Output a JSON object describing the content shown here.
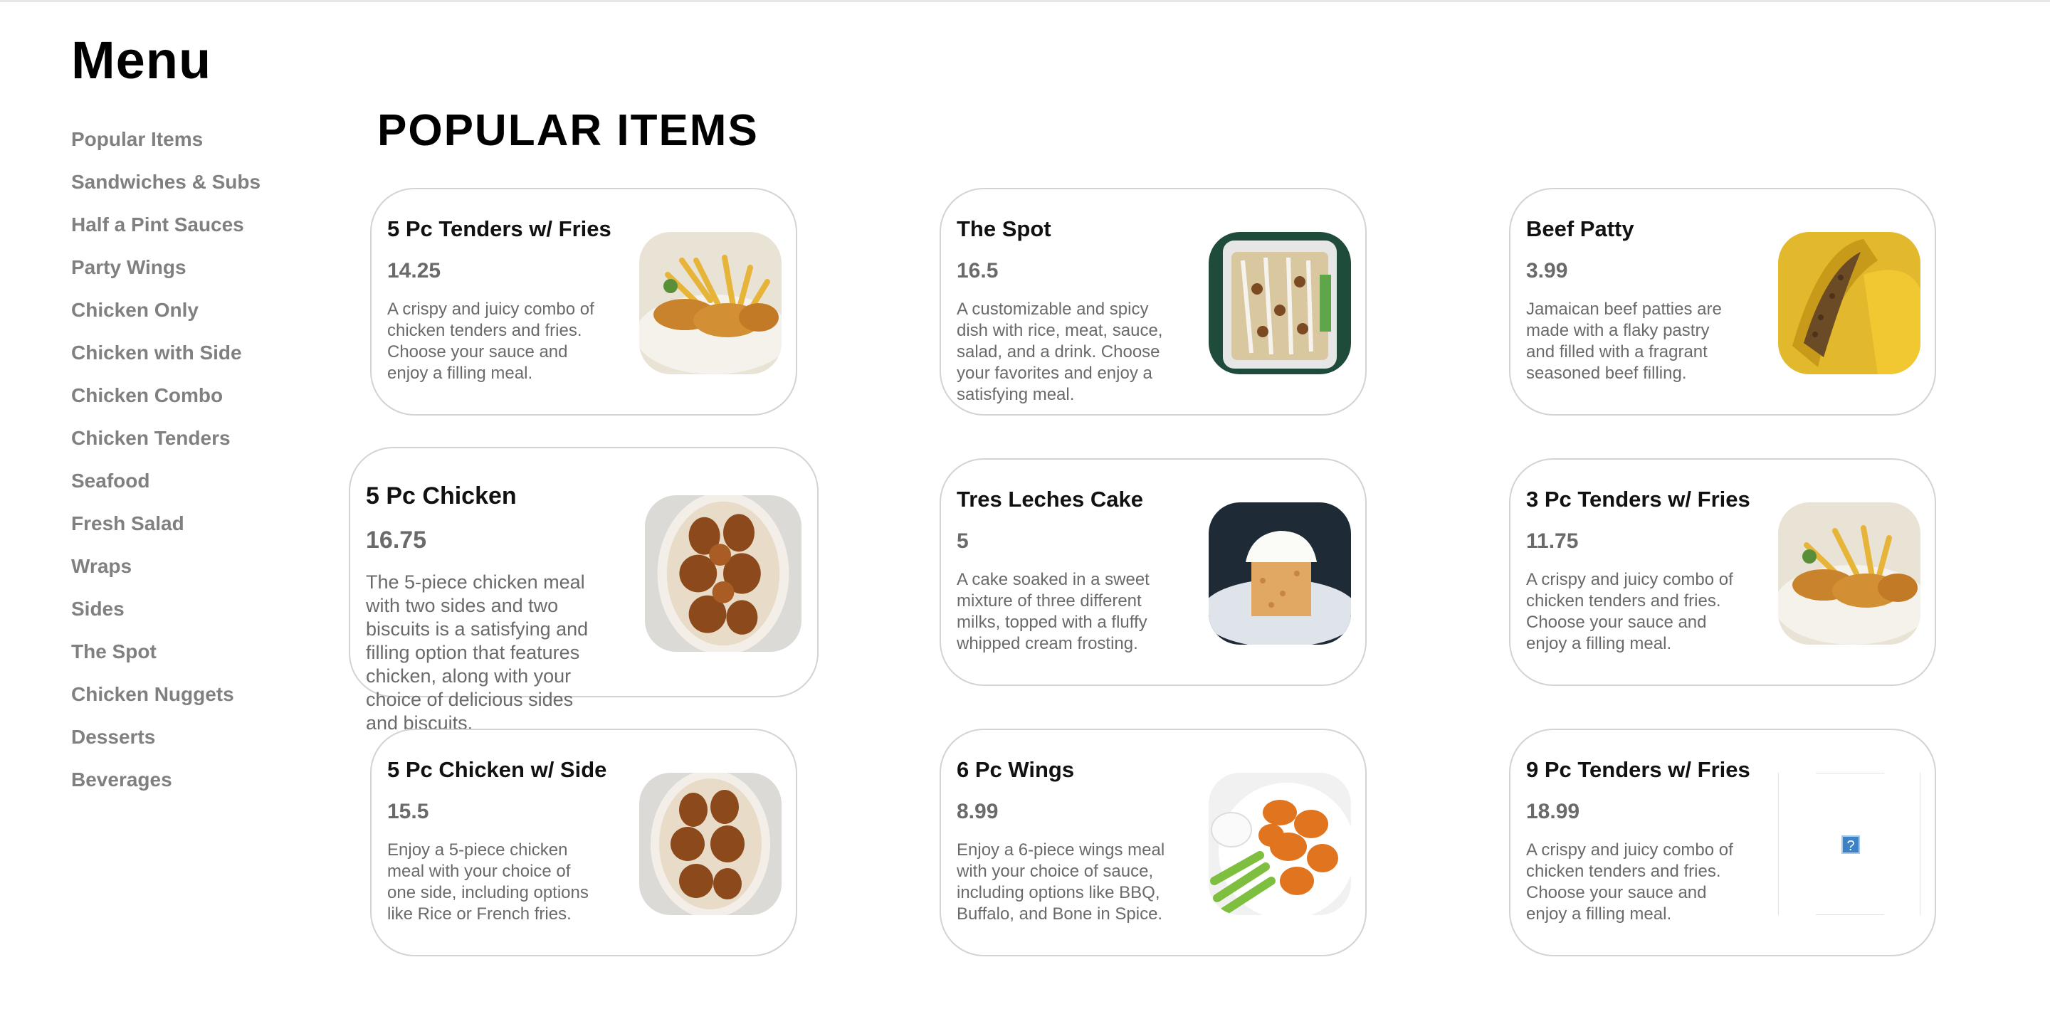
{
  "page": {
    "title": "Menu",
    "section_title": "POPULAR ITEMS"
  },
  "sidebar": {
    "items": [
      {
        "label": "Popular Items"
      },
      {
        "label": "Sandwiches & Subs"
      },
      {
        "label": "Half a Pint Sauces"
      },
      {
        "label": "Party Wings"
      },
      {
        "label": "Chicken Only"
      },
      {
        "label": "Chicken with Side"
      },
      {
        "label": "Chicken Combo"
      },
      {
        "label": "Chicken Tenders"
      },
      {
        "label": "Seafood"
      },
      {
        "label": "Fresh Salad"
      },
      {
        "label": "Wraps"
      },
      {
        "label": "Sides"
      },
      {
        "label": "The Spot"
      },
      {
        "label": "Chicken Nuggets"
      },
      {
        "label": "Desserts"
      },
      {
        "label": "Beverages"
      }
    ]
  },
  "items": [
    {
      "name": "5 Pc Tenders w/ Fries",
      "price": "14.25",
      "description": "A crispy and juicy combo of\nchicken tenders and fries.\nChoose your sauce and\nenjoy a filling meal.",
      "image": "tenders-and-fries-photo"
    },
    {
      "name": "The Spot",
      "price": "16.5",
      "description": "A customizable and spicy\ndish with rice, meat, sauce,\nsalad, and a drink. Choose\nyour favorites and enjoy a\nsatisfying meal.",
      "image": "rice-bowl-photo"
    },
    {
      "name": "Beef Patty",
      "price": "3.99",
      "description": "Jamaican beef patties are\nmade with a flaky pastry\nand filled with a fragrant\nseasoned beef filling.",
      "image": "beef-patty-photo"
    },
    {
      "name": "5 Pc Chicken",
      "price": "16.75",
      "description": "The 5-piece chicken meal\nwith two sides and two\nbiscuits is a satisfying and\nfilling option that features\nchicken, along with your\nchoice of delicious sides\nand biscuits.",
      "image": "fried-chicken-photo"
    },
    {
      "name": "Tres Leches Cake",
      "price": "5",
      "description": "A cake soaked in a sweet\nmixture of three different\nmilks, topped with a fluffy\nwhipped cream frosting.",
      "image": "cake-photo"
    },
    {
      "name": "3 Pc Tenders w/ Fries",
      "price": "11.75",
      "description": "A crispy and juicy combo of\nchicken tenders and fries.\nChoose your sauce and\nenjoy a filling meal.",
      "image": "tenders-and-fries-photo"
    },
    {
      "name": "5 Pc Chicken w/ Side",
      "price": "15.5",
      "description": "Enjoy a 5-piece chicken\nmeal with your choice of\none side, including options\nlike Rice or French fries.",
      "image": "fried-chicken-photo"
    },
    {
      "name": "6 Pc Wings",
      "price": "8.99",
      "description": "Enjoy a 6-piece wings meal\nwith your choice of sauce,\nincluding options like BBQ,\nBuffalo, and Bone in Spice.",
      "image": "wings-photo"
    },
    {
      "name": "9 Pc Tenders w/ Fries",
      "price": "18.99",
      "description": "A crispy and juicy combo of\nchicken tenders and fries.\nChoose your sauce and\nenjoy a filling meal.",
      "image": "broken-image-icon"
    }
  ],
  "colors": {
    "muted_text": "#808080",
    "card_border": "#d3d3d3",
    "body_text": "#6a6a6a"
  }
}
